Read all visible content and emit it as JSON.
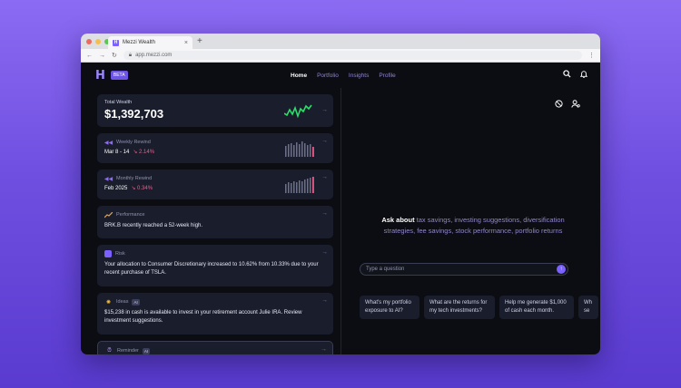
{
  "browser": {
    "tab_title": "Mezzi Wealth",
    "new_tab": "+",
    "url": "app.mezzi.com"
  },
  "header": {
    "logo": "H",
    "beta": "BETA",
    "nav": [
      "Home",
      "Portfolio",
      "Insights",
      "Profile"
    ]
  },
  "cards": {
    "wealth": {
      "label": "Total Wealth",
      "value": "$1,392,703"
    },
    "weekly": {
      "label": "Weekly Rewind",
      "range": "Mar 8 - 14",
      "change": "↘ 2.14%"
    },
    "monthly": {
      "label": "Monthly Rewind",
      "range": "Feb 2025",
      "change": "↘ 0.34%"
    },
    "performance": {
      "label": "Performance",
      "text": "BRK.B recently reached a 52-week high."
    },
    "risk": {
      "label": "Risk",
      "text": "Your allocation to Consumer Discretionary increased to 10.62% from 10.33% due to your recent purchase of TSLA."
    },
    "ideas": {
      "label": "Ideas",
      "badge": "AI",
      "text": "$15,238 in cash is available to invest in your retirement account Julie IRA. Review investment suggestions."
    },
    "reminder": {
      "label": "Reminder",
      "badge": "AI"
    }
  },
  "ask": {
    "lead": "Ask about",
    "topics": "tax savings, investing suggestions, diversification strategies, fee savings, stock performance, portfolio returns",
    "placeholder": "Type a question",
    "suggestions": [
      "What's my portfolio exposure to AI?",
      "What are the returns for my tech investments?",
      "Help me generate $1,000 of cash each month.",
      "Wh se"
    ]
  },
  "colors": {
    "accent": "#7b61ff",
    "negative": "#e4608a",
    "card": "#1a1d2c"
  }
}
